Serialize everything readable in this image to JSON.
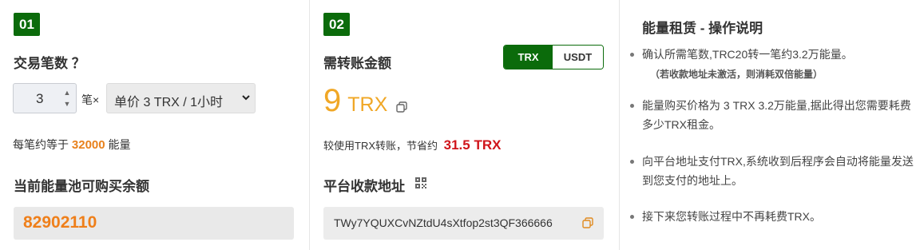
{
  "step1": {
    "badge": "01",
    "title": "交易笔数 ？",
    "quantity": "3",
    "unit": "笔×",
    "price_select": "单价 3 TRX / 1小时",
    "note_prefix": "每笔约等于",
    "energy": "32000",
    "note_suffix": "能量",
    "pool_title": "当前能量池可购买余额",
    "pool_value": "82902110"
  },
  "step2": {
    "badge": "02",
    "title": "需转账金额",
    "toggle": {
      "active": "TRX",
      "inactive": "USDT"
    },
    "amount": "9",
    "amount_unit": "TRX",
    "save_prefix": "较使用TRX转账，节省约",
    "save_value": "31.5 TRX",
    "address_title": "平台收款地址",
    "address": "TWy7YQUXCvNZtdU4sXtfop2st3QF366666"
  },
  "info": {
    "title": "能量租赁 - 操作说明",
    "items": [
      "确认所需笔数,TRC20转一笔约3.2万能量。",
      "能量购买价格为 3 TRX 3.2万能量,据此得出您需要耗费多少TRX租金。",
      "向平台地址支付TRX,系统收到后程序会自动将能量发送到您支付的地址上。",
      "接下来您转账过程中不再耗费TRX。"
    ],
    "item1_note": "（若收款地址未激活，则消耗双倍能量）"
  },
  "icons": [
    "spinner-up-icon",
    "spinner-down-icon",
    "dropdown-arrow-icon",
    "copy-icon",
    "qr-code-icon",
    "bullet-icon"
  ],
  "colors": {
    "brand_green": "#0b6b0b",
    "orange": "#ef7f1a",
    "amount_gold": "#f0a726",
    "red": "#d0151b"
  }
}
